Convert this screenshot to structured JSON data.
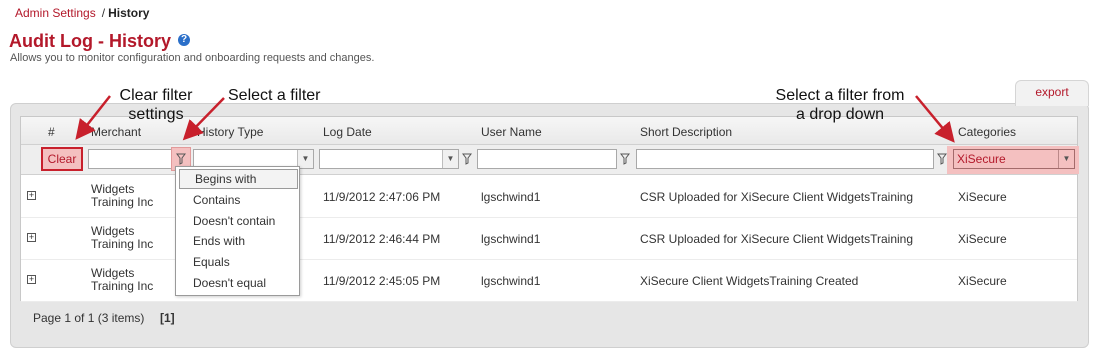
{
  "breadcrumb": {
    "link": "Admin Settings",
    "separator": "/",
    "current": "History"
  },
  "page": {
    "title": "Audit Log - History",
    "help_icon": "?",
    "subtitle": "Allows you to monitor configuration and onboarding requests and changes."
  },
  "toolbar": {
    "export_label": "export"
  },
  "columns": [
    "#",
    "Merchant",
    "History Type",
    "Log Date",
    "User Name",
    "Short Description",
    "Categories"
  ],
  "filters": {
    "clear_label": "Clear",
    "category_selected": "XiSecure",
    "operators": [
      "Begins with",
      "Contains",
      "Doesn't contain",
      "Ends with",
      "Equals",
      "Doesn't equal"
    ],
    "active_operator": "Begins with"
  },
  "rows": [
    {
      "expand": "+",
      "merchant": "Widgets Training Inc",
      "log_date": "11/9/2012 2:47:06 PM",
      "user": "lgschwind1",
      "description": "CSR Uploaded for XiSecure Client WidgetsTraining",
      "category": "XiSecure"
    },
    {
      "expand": "+",
      "merchant": "Widgets Training Inc",
      "log_date": "11/9/2012 2:46:44 PM",
      "user": "lgschwind1",
      "description": "CSR Uploaded for XiSecure Client WidgetsTraining",
      "category": "XiSecure"
    },
    {
      "expand": "+",
      "merchant": "Widgets Training Inc",
      "log_date": "11/9/2012 2:45:05 PM",
      "user": "lgschwind1",
      "description": "XiSecure Client WidgetsTraining Created",
      "category": "XiSecure"
    }
  ],
  "pager": {
    "info": "Page 1 of 1 (3 items)",
    "current_page": "[1]"
  },
  "callouts": {
    "clear_filter_line1": "Clear filter",
    "clear_filter_line2": "settings",
    "select_filter": "Select a filter",
    "dropdown_line1": "Select a filter from",
    "dropdown_line2": "a drop down"
  },
  "colors": {
    "accent": "#b3182a",
    "highlight": "#f4c0c0",
    "arrow": "#c8202c"
  }
}
